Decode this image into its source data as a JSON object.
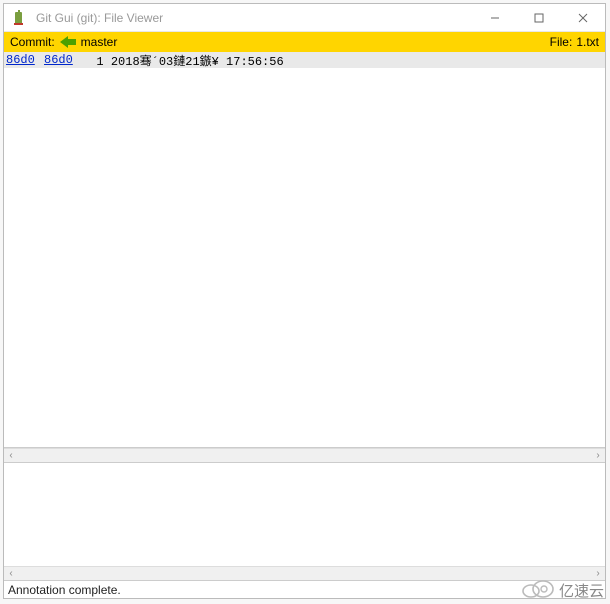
{
  "window": {
    "title": "Git Gui (git): File Viewer"
  },
  "commitbar": {
    "label": "Commit:",
    "branch": "master",
    "file_label": "File:",
    "file_name": "1.txt"
  },
  "content": {
    "hash1": "86d0",
    "hash2": "86d0",
    "line": "   1 2018骞´03鏈21鏃¥ 17:56:56"
  },
  "status": {
    "text": "Annotation complete."
  },
  "watermark": {
    "text": "亿速云"
  }
}
